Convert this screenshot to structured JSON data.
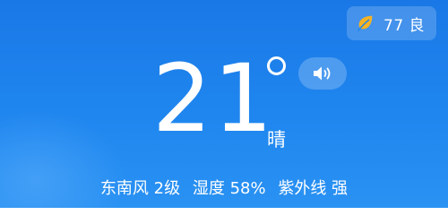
{
  "air_quality": {
    "icon": "leaf-icon",
    "icon_color": "#f6b324",
    "value": "77",
    "label": "良"
  },
  "current": {
    "temperature": "21",
    "degree_symbol_icon": "degree-icon",
    "condition": "晴",
    "speak_icon": "speaker-icon"
  },
  "details": {
    "wind": "东南风 2级",
    "humidity": "湿度 58%",
    "uv": "紫外线 强"
  },
  "colors": {
    "background_top": "#1a78e6",
    "background_bottom": "#2a92f3",
    "text": "#ffffff"
  }
}
